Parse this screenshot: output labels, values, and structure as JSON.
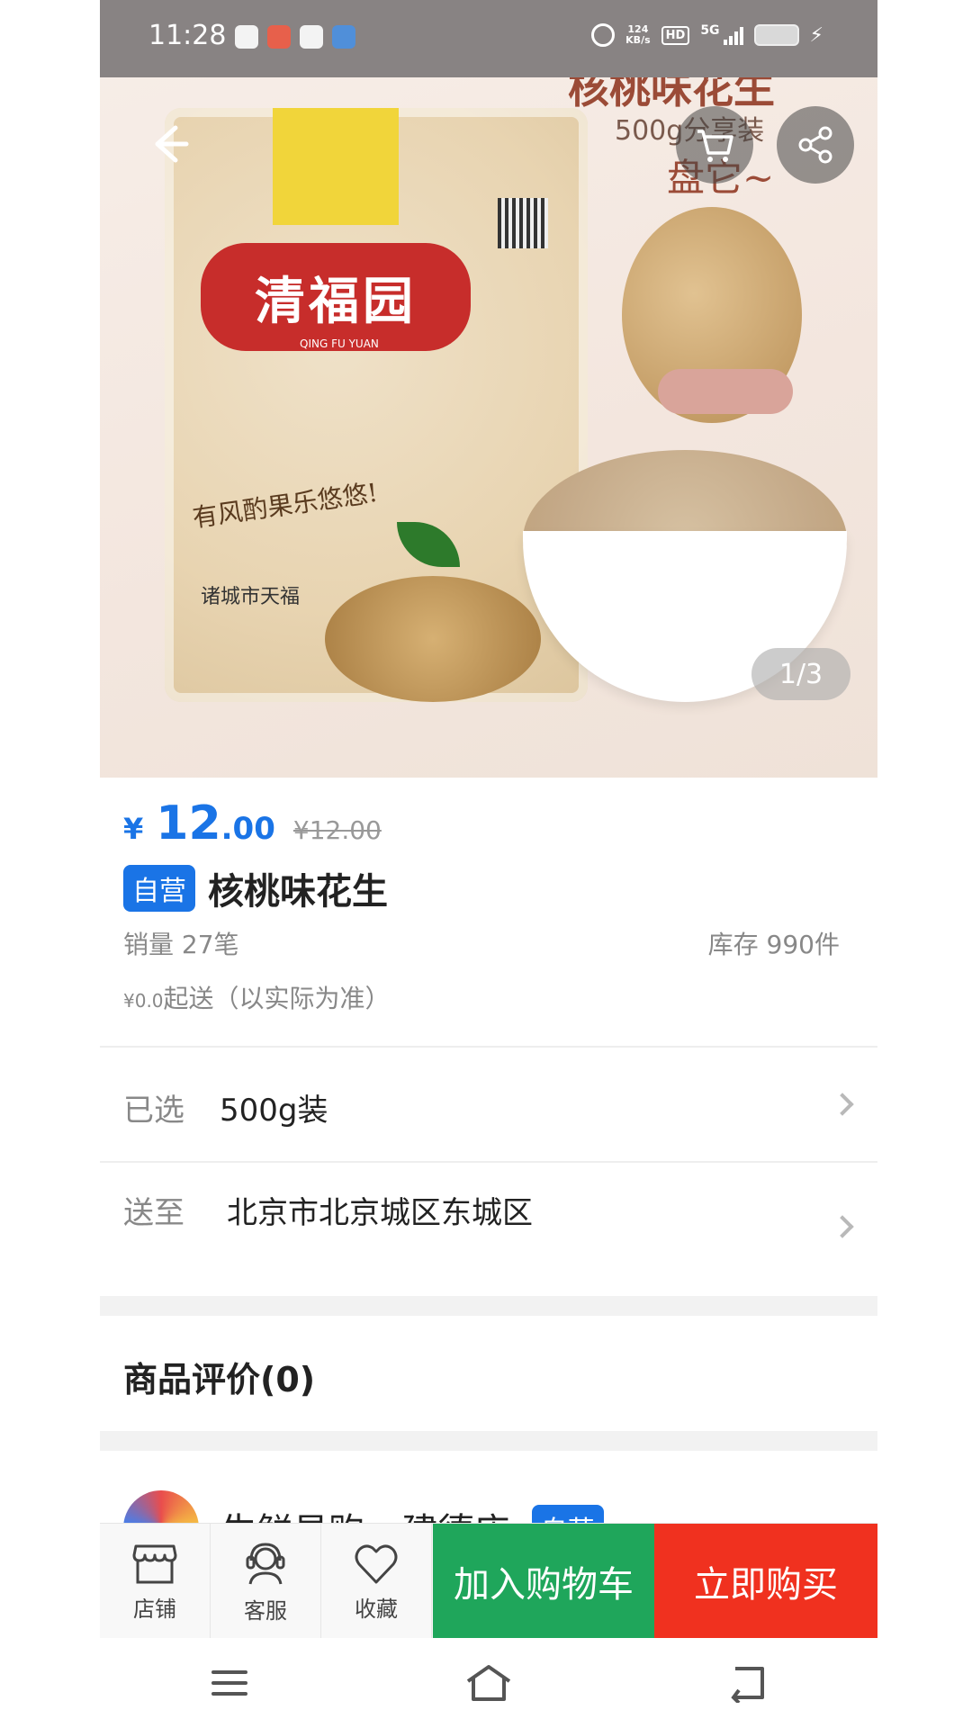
{
  "status_bar": {
    "time": "11:28",
    "net_speed_value": "124",
    "net_speed_unit": "KB/s",
    "hd_label": "HD",
    "network_label": "5G"
  },
  "hero": {
    "title": "核桃味花生",
    "subtitle": "500g分享装",
    "hand_text": "盘它~",
    "brand_text": "清福园",
    "brand_pinyin": "QING FU YUAN",
    "bag_slogan": "有风酌果乐悠悠!",
    "bag_maker": "诸城市天福",
    "page_indicator": "1/3"
  },
  "product": {
    "currency": "¥",
    "price_int": "12",
    "price_dec": ".00",
    "price_old": "¥12.00",
    "badge": "自营",
    "title": "核桃味花生",
    "sales": "销量 27笔",
    "stock": "库存 990件",
    "delivery_currency": "¥0.0",
    "delivery_rest": "起送（以实际为准）"
  },
  "selected": {
    "label": "已选",
    "value": "500g装"
  },
  "ship_to": {
    "label": "送至",
    "value": "北京市北京城区东城区"
  },
  "reviews": {
    "title": "商品评价(0)"
  },
  "store": {
    "name": "生鲜易购 --建德店",
    "badge": "自营"
  },
  "bottom_bar": {
    "shop_label": "店铺",
    "service_label": "客服",
    "favorite_label": "收藏",
    "add_to_cart": "加入购物车",
    "buy_now": "立即购买"
  },
  "colors": {
    "accent_blue": "#1a74e6",
    "cart_green": "#1fa65b",
    "buy_red": "#f0311f"
  }
}
